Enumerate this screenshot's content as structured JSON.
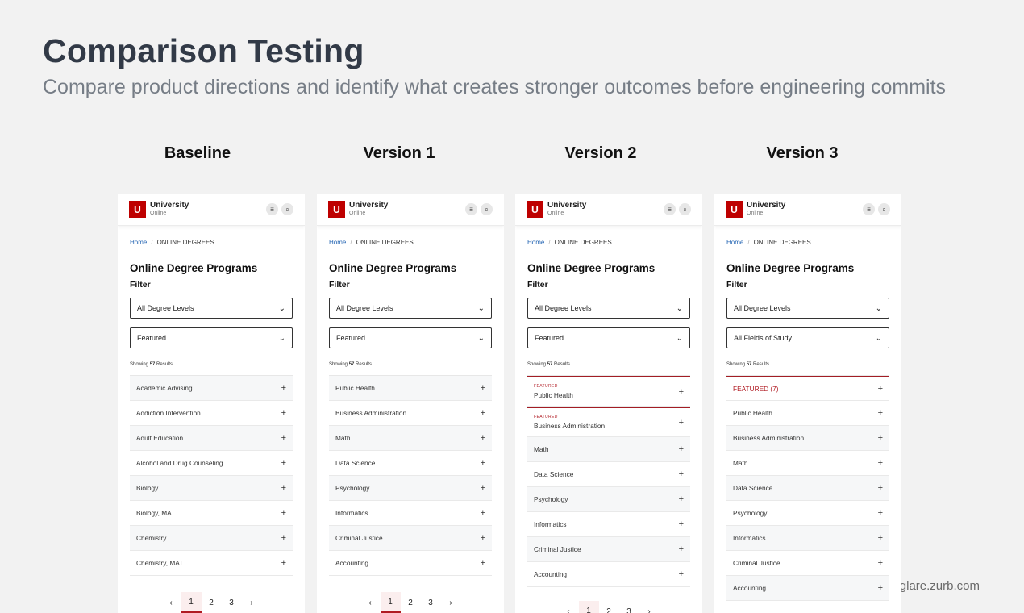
{
  "hero": {
    "title": "Comparison Testing",
    "subtitle": "Compare product directions and identify what creates stronger outcomes before engineering commits"
  },
  "watermark": "glare.zurb.com",
  "colors": {
    "brand_red": "#be0000",
    "featured_red": "#a31d24",
    "link_blue": "#2566b4"
  },
  "common": {
    "logo_letter": "U",
    "logo_name": "University",
    "logo_sub": "Online",
    "menu_icon": "≡",
    "search_icon": "⌕",
    "crumb_home": "Home",
    "crumb_sep": "/",
    "crumb_current": "ONLINE DEGREES",
    "page_title": "Online Degree Programs",
    "filter_label": "Filter",
    "degree_select": "All Degree Levels",
    "chevron": "⌄",
    "results_prefix": "Showing",
    "results_count": "57",
    "results_suffix": "Results",
    "plus": "+",
    "prev": "‹",
    "next": "›",
    "pages": [
      "1",
      "2",
      "3"
    ]
  },
  "columns": [
    {
      "title": "Baseline",
      "second_select": "Featured",
      "rows": [
        "Academic Advising",
        "Addiction Intervention",
        "Adult Education",
        "Alcohol and Drug Counseling",
        "Biology",
        "Biology, MAT",
        "Chemistry",
        "Chemistry, MAT"
      ]
    },
    {
      "title": "Version 1",
      "second_select": "Featured",
      "rows": [
        "Public Health",
        "Business Administration",
        "Math",
        "Data Science",
        "Psychology",
        "Informatics",
        "Criminal Justice",
        "Accounting"
      ]
    },
    {
      "title": "Version 2",
      "second_select": "Featured",
      "featured_tag": "FEATURED",
      "featured_rows": [
        "Public Health",
        "Business Administration"
      ],
      "rows": [
        "Math",
        "Data Science",
        "Psychology",
        "Informatics",
        "Criminal Justice",
        "Accounting"
      ]
    },
    {
      "title": "Version 3",
      "second_select": "All Fields of Study",
      "featured_group": "FEATURED (7)",
      "rows": [
        "Public Health",
        "Business Administration",
        "Math",
        "Data Science",
        "Psychology",
        "Informatics",
        "Criminal Justice",
        "Accounting"
      ]
    }
  ]
}
